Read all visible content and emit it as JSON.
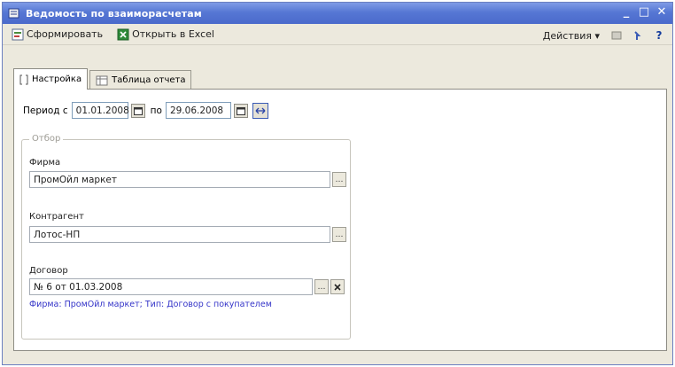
{
  "window": {
    "title": "Ведомость по взаиморасчетам",
    "controls": [
      "_",
      "□",
      "✕"
    ]
  },
  "toolbar": {
    "generate_label": "Сформировать",
    "excel_label": "Открыть в Excel",
    "actions_label": "Действия ▾",
    "help_label": "?"
  },
  "tabs": [
    {
      "label": "Настройка",
      "active": true
    },
    {
      "label": "Таблица отчета",
      "active": false
    }
  ],
  "period": {
    "from_label": "Период с",
    "from_value": "01.01.2008",
    "to_label": "по",
    "to_value": "29.06.2008"
  },
  "filter": {
    "legend": "Отбор",
    "firm_label": "Фирма",
    "firm_value": "ПромОйл маркет",
    "counterparty_label": "Контрагент",
    "counterparty_value": "Лотос-НП",
    "contract_label": "Договор",
    "contract_value": "№ 6 от 01.03.2008",
    "contract_note": "Фирма: ПромОйл маркет; Тип: Договор с покупателем"
  },
  "colors": {
    "titlebar": "#5677d4",
    "window_bg": "#ece9dd",
    "note_text": "#3434c8"
  }
}
